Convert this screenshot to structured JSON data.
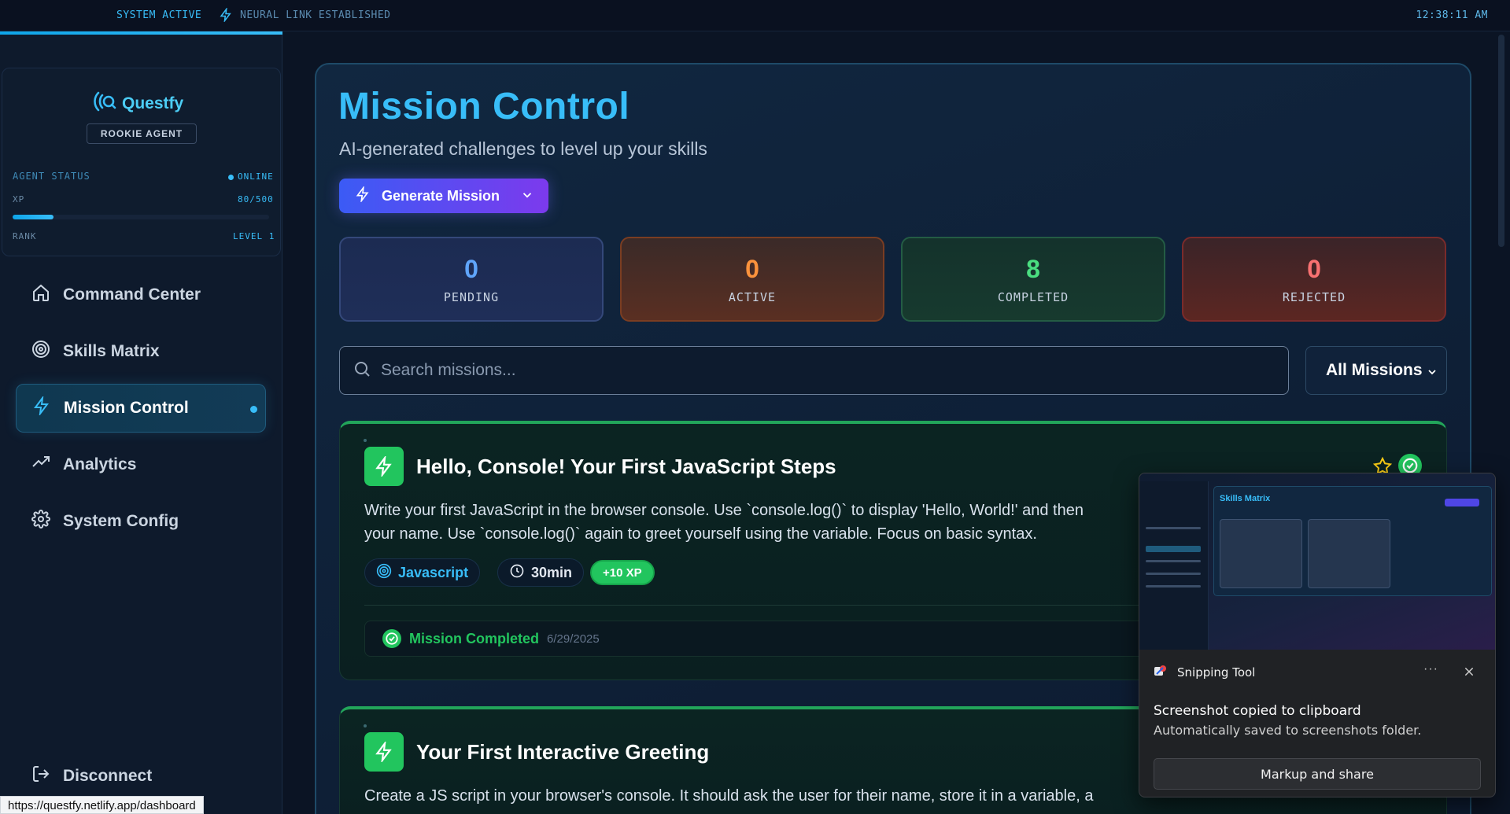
{
  "topbar": {
    "system_status": "SYSTEM ACTIVE",
    "neural_status": "NEURAL LINK ESTABLISHED",
    "clock": "12:38:11 AM"
  },
  "agent": {
    "brand": "Questfy",
    "rank_badge": "ROOKIE AGENT",
    "status_label": "AGENT STATUS",
    "online": "ONLINE",
    "xp_label": "XP",
    "xp_value": "80/500",
    "xp_progress": 0.16,
    "rank_label": "RANK",
    "rank_value": "LEVEL 1"
  },
  "sidebar": {
    "items": [
      {
        "label": "Command Center",
        "icon": "home-icon"
      },
      {
        "label": "Skills Matrix",
        "icon": "target-icon"
      },
      {
        "label": "Mission Control",
        "icon": "bolt-icon",
        "active": true
      },
      {
        "label": "Analytics",
        "icon": "trend-icon"
      },
      {
        "label": "System Config",
        "icon": "gear-icon"
      }
    ],
    "disconnect": "Disconnect"
  },
  "status_url": "https://questfy.netlify.app/dashboard",
  "main": {
    "title": "Mission Control",
    "subtitle": "AI-generated challenges to level up your skills",
    "generate_button": "Generate Mission",
    "stats": {
      "pending": {
        "value": "0",
        "label": "PENDING"
      },
      "active": {
        "value": "0",
        "label": "ACTIVE"
      },
      "completed": {
        "value": "8",
        "label": "COMPLETED"
      },
      "rejected": {
        "value": "0",
        "label": "REJECTED"
      }
    },
    "search_placeholder": "Search missions...",
    "filter_selected": "All Missions",
    "missions": [
      {
        "title": "Hello, Console! Your First JavaScript Steps",
        "description_1": "Write your first JavaScript in the browser console. Use `console.log()` to display 'Hello, World!' and then",
        "description_2": "your name. Use `console.log()` again to greet yourself using the variable. Focus on basic syntax.",
        "skill": "Javascript",
        "duration": "30min",
        "xp": "+10 XP",
        "status": "Mission Completed",
        "date": "6/29/2025"
      },
      {
        "title": "Your First Interactive Greeting",
        "description_1": "Create a JS script in your browser's console. It should ask the user for their name, store it in a variable, a"
      }
    ]
  },
  "colors": {
    "accent": "#38bdf8",
    "success": "#22c55e",
    "pending": "#60a5fa",
    "active": "#fb923c",
    "rejected": "#ef4444"
  },
  "toast": {
    "app": "Snipping Tool",
    "more": "···",
    "heading": "Screenshot copied to clipboard",
    "sub": "Automatically saved to screenshots folder.",
    "button": "Markup and share",
    "preview_title": "Skills Matrix"
  }
}
